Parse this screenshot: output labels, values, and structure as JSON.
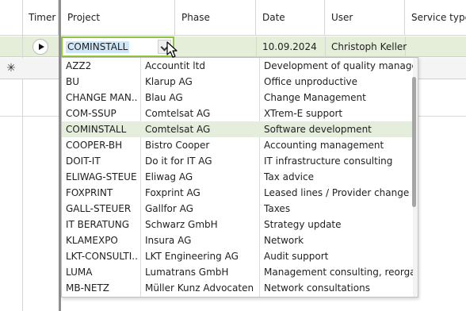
{
  "columns": {
    "timer": "Timer",
    "project": "Project",
    "phase": "Phase",
    "date": "Date",
    "user": "User",
    "service_type": "Service type"
  },
  "active_row": {
    "project_value": "COMINSTALL",
    "date": "10.09.2024",
    "user": "Christoph Keller"
  },
  "new_row_symbol": "✳",
  "dropdown": {
    "items": [
      {
        "code": "AZZ2",
        "customer": "Accountit ltd",
        "description": "Development of quality manage..."
      },
      {
        "code": "BU",
        "customer": "Klarup AG",
        "description": "Office unproductive"
      },
      {
        "code": "CHANGE MAN...",
        "customer": "Blau AG",
        "description": "Change Management"
      },
      {
        "code": "COM-SSUP",
        "customer": "Comtelsat AG",
        "description": "XTrem-E support"
      },
      {
        "code": "COMINSTALL",
        "customer": "Comtelsat AG",
        "description": "Software development"
      },
      {
        "code": "COOPER-BH",
        "customer": "Bistro Cooper",
        "description": "Accounting management"
      },
      {
        "code": "DOIT-IT",
        "customer": "Do it for IT AG",
        "description": "IT infrastructure consulting"
      },
      {
        "code": "ELIWAG-STEUER",
        "customer": "Eliwag AG",
        "description": "Tax advice"
      },
      {
        "code": "FOXPRINT",
        "customer": "Foxprint AG",
        "description": "Leased lines / Provider change"
      },
      {
        "code": "GALL-STEUER",
        "customer": "Gallfor AG",
        "description": "Taxes"
      },
      {
        "code": "IT BERATUNG",
        "customer": "Schwarz GmbH",
        "description": "Strategy update"
      },
      {
        "code": "KLAMEXPO",
        "customer": "Insura AG",
        "description": "Network"
      },
      {
        "code": "LKT-CONSULTI...",
        "customer": "LKT Engineering AG",
        "description": "Audit support"
      },
      {
        "code": "LUMA",
        "customer": "Lumatrans GmbH",
        "description": "Management consulting, reorgani..."
      },
      {
        "code": "MB-NETZ",
        "customer": "Müller Kunz Advocaten",
        "description": "Network consultations"
      }
    ],
    "selected_index": 4
  },
  "colors": {
    "selection_green": "#e4eed8",
    "combo_border": "#8dc53e",
    "text_highlight": "#cfe6f7"
  },
  "icons": [
    "play-icon",
    "chevron-down-icon",
    "new-row-asterisk-icon",
    "mouse-cursor-icon"
  ]
}
